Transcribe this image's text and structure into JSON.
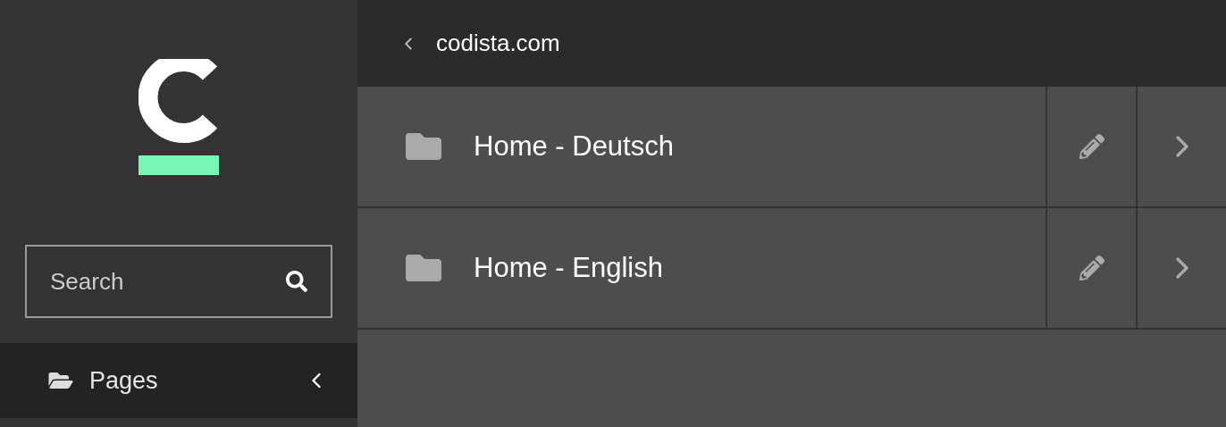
{
  "sidebar": {
    "search": {
      "placeholder": "Search"
    },
    "nav_items": [
      {
        "label": "Pages",
        "expanded": false
      }
    ]
  },
  "breadcrumb": {
    "label": "codista.com"
  },
  "pages": [
    {
      "title": "Home - Deutsch"
    },
    {
      "title": "Home - English"
    }
  ]
}
